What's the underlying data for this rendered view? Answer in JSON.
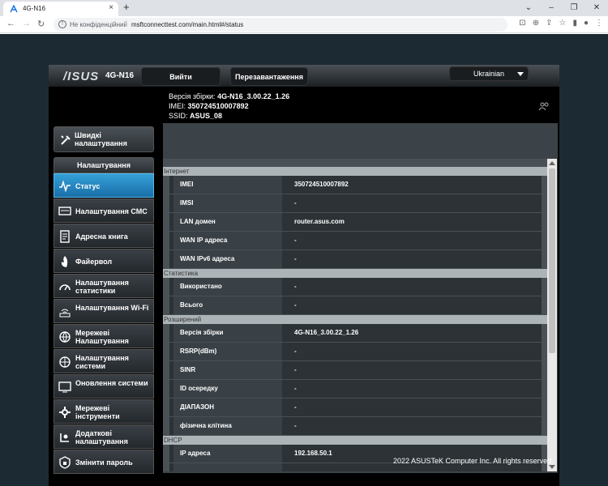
{
  "browser": {
    "tab_title": "4G-N16",
    "not_secure": "Не конфіденційний",
    "url": "msftconnecttest.com/main.html#/status"
  },
  "router": {
    "logo": "/ISUS",
    "model": "4G-N16",
    "logout": "Вийти",
    "reboot": "Перезавантаження",
    "language": "Ukrainian",
    "firmware_label": "Версія збірки:",
    "firmware": "4G-N16_3.00.22_1.26",
    "imei_label": "IMEI:",
    "imei": "350724510007892",
    "ssid_label": "SSID:",
    "ssid": "ASUS_08",
    "quick_label": "Швидкі налаштування",
    "settings_header": "Налаштування",
    "menu": [
      {
        "label": "Статус",
        "icon": "status-wave-icon"
      },
      {
        "label": "Налаштування СМС",
        "icon": "sms-icon"
      },
      {
        "label": "Адресна книга",
        "icon": "address-book-icon"
      },
      {
        "label": "Файервол",
        "icon": "firewall-icon"
      },
      {
        "label": "Налаштування статистики",
        "icon": "statistics-gauge-icon"
      },
      {
        "label": "Налаштування Wi-Fi",
        "icon": "wifi-icon"
      },
      {
        "label": "Мережеві Налаштування",
        "icon": "network-globe-icon"
      },
      {
        "label": "Налаштування системи",
        "icon": "system-globe-icon"
      },
      {
        "label": "Оновлення системи",
        "icon": "update-monitor-icon"
      },
      {
        "label": "Мережеві інструменти",
        "icon": "tools-gear-icon"
      },
      {
        "label": "Додаткові налаштування",
        "icon": "advanced-settings-icon"
      },
      {
        "label": "Змінити пароль",
        "icon": "password-lock-icon"
      }
    ],
    "sections": {
      "internet": {
        "title": "Інтернет",
        "rows": [
          [
            "IMEI",
            "350724510007892"
          ],
          [
            "IMSI",
            "-"
          ],
          [
            "LAN домен",
            "router.asus.com"
          ],
          [
            "WAN IP адреса",
            "-"
          ],
          [
            "WAN IPv6 адреса",
            "-"
          ]
        ]
      },
      "stats": {
        "title": "Статистика",
        "rows": [
          [
            "Використано",
            "-"
          ],
          [
            "Всього",
            "-"
          ]
        ]
      },
      "advanced": {
        "title": "Розширений",
        "rows": [
          [
            "Версія збірки",
            "4G-N16_3.00.22_1.26"
          ],
          [
            "RSRP(dBm)",
            "-"
          ],
          [
            "SINR",
            "-"
          ],
          [
            "ID осередку",
            "-"
          ],
          [
            "ДІАПАЗОН",
            "-"
          ],
          [
            "фізична клітина",
            "-"
          ]
        ]
      },
      "dhcp": {
        "title": "DHCP",
        "rows": [
          [
            "IP адреса",
            "192.168.50.1"
          ]
        ]
      }
    },
    "copyright": "2022 ASUSTeK Computer Inc. All rights reserved."
  }
}
